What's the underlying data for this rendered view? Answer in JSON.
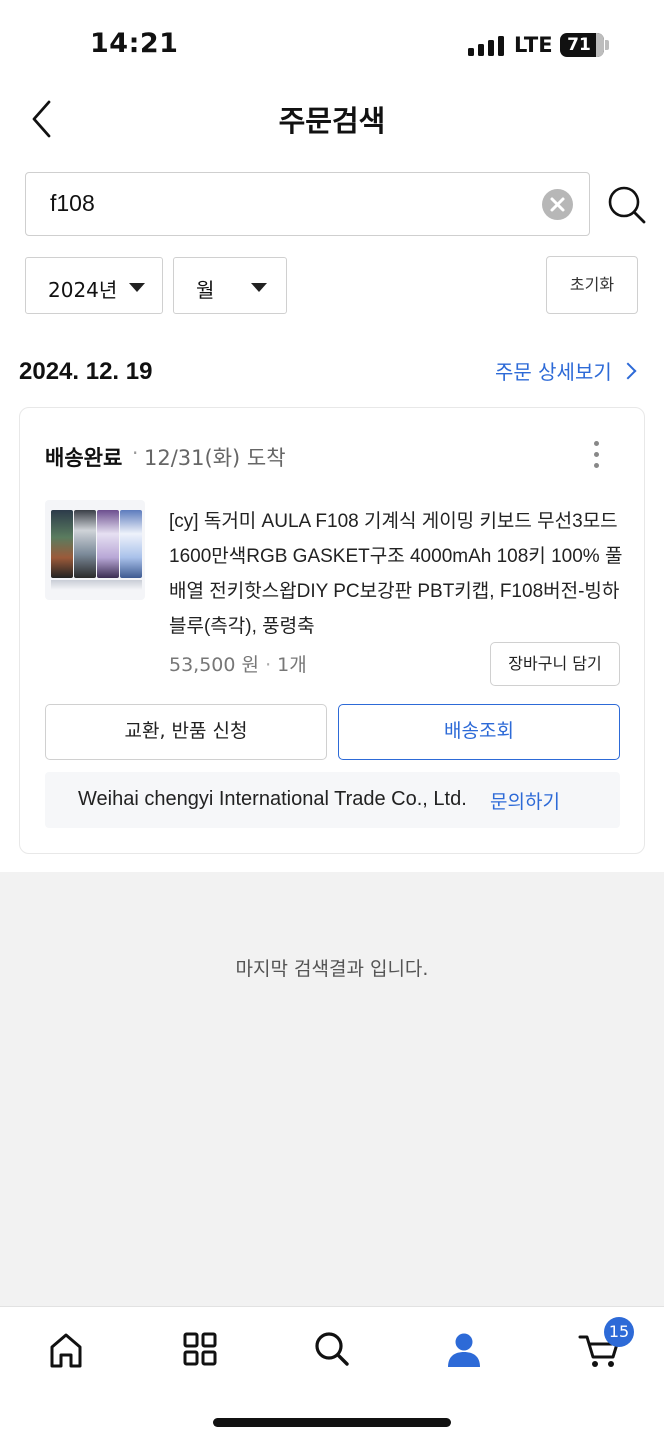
{
  "status_bar": {
    "time": "14:21",
    "network": "LTE",
    "battery": "71"
  },
  "header": {
    "title": "주문검색",
    "back_icon": "chevron-left-icon"
  },
  "search": {
    "value": "f108",
    "clear_icon": "clear-circle-icon",
    "search_icon": "search-icon"
  },
  "filters": {
    "year": "2024년",
    "month": "월",
    "reset_label": "초기화"
  },
  "order_group": {
    "date": "2024. 12. 19",
    "detail_link": "주문 상세보기"
  },
  "order": {
    "status": "배송완료",
    "separator": "·",
    "arrival": "12/31(화) 도착",
    "product_name": "[cy] 독거미 AULA F108 기계식 게이밍 키보드 무선3모드 1600만색RGB GASKET구조 4000mAh 108키 100% 풀배열 전키핫스왑DIY PC보강판 PBT키캡, F108버전-빙하블루(측각), 풍령축",
    "price": "53,500 원",
    "quantity": "1개",
    "cart_add_label": "장바구니 담기",
    "exchange_label": "교환, 반품 신청",
    "tracking_label": "배송조회",
    "seller": "Weihai chengyi International Trade Co., Ltd.",
    "inquiry_label": "문의하기"
  },
  "end_message": "마지막 검색결과 입니다.",
  "bottom_nav": {
    "items": [
      "home-icon",
      "category-grid-icon",
      "search-icon",
      "my-page-person-icon",
      "cart-icon"
    ],
    "cart_badge": "15"
  },
  "colors": {
    "accent": "#2d6ad7",
    "background_gray": "#f2f2f2",
    "text": "#111111"
  }
}
